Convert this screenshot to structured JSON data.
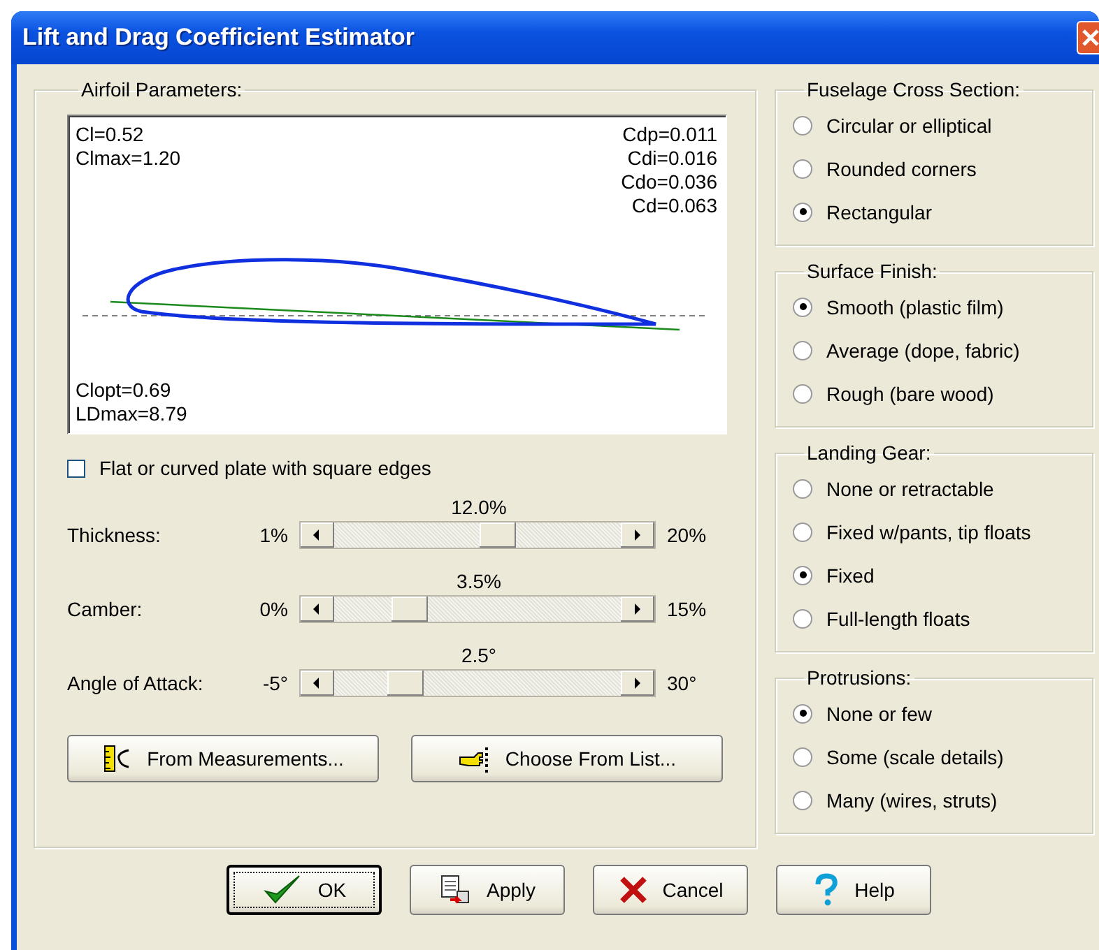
{
  "window": {
    "title": "Lift and Drag Coefficient Estimator"
  },
  "airfoil": {
    "legend": "Airfoil Parameters:",
    "readouts_top_left": [
      "Cl=0.52",
      "Clmax=1.20"
    ],
    "readouts_top_right": [
      "Cdp=0.011",
      "Cdi=0.016",
      "Cdo=0.036",
      "Cd=0.063"
    ],
    "readouts_bottom_left": [
      "Clopt=0.69",
      "LDmax=8.79"
    ],
    "flat_plate": {
      "label": "Flat or curved plate with square edges",
      "checked": false
    },
    "sliders": [
      {
        "label": "Thickness:",
        "min_label": "1%",
        "max_label": "20%",
        "reading": "12.0%",
        "level": 0.58
      },
      {
        "label": "Camber:",
        "min_label": "0%",
        "max_label": "15%",
        "reading": "3.5%",
        "level": 0.23
      },
      {
        "label": "Angle of Attack:",
        "min_label": "-5°",
        "max_label": "30°",
        "reading": "2.5°",
        "level": 0.21
      }
    ],
    "buttons": [
      {
        "label": "From Measurements...",
        "kind": "measure"
      },
      {
        "label": "Choose From List...",
        "kind": "list"
      }
    ]
  },
  "groups": [
    {
      "title": "Fuselage Cross Section:",
      "options": [
        {
          "label": "Circular or elliptical",
          "selected": false
        },
        {
          "label": "Rounded corners",
          "selected": false
        },
        {
          "label": "Rectangular",
          "selected": true
        }
      ]
    },
    {
      "title": "Surface Finish:",
      "options": [
        {
          "label": "Smooth (plastic film)",
          "selected": true
        },
        {
          "label": "Average (dope, fabric)",
          "selected": false
        },
        {
          "label": "Rough (bare wood)",
          "selected": false
        }
      ]
    },
    {
      "title": "Landing Gear:",
      "options": [
        {
          "label": "None or retractable",
          "selected": false
        },
        {
          "label": "Fixed w/pants, tip floats",
          "selected": false
        },
        {
          "label": "Fixed",
          "selected": true
        },
        {
          "label": "Full-length floats",
          "selected": false
        }
      ]
    },
    {
      "title": "Protrusions:",
      "options": [
        {
          "label": "None or few",
          "selected": true
        },
        {
          "label": "Some (scale details)",
          "selected": false
        },
        {
          "label": "Many (wires, struts)",
          "selected": false
        }
      ]
    }
  ],
  "dialog_buttons": [
    {
      "label": "OK",
      "kind": "ok",
      "default": true
    },
    {
      "label": "Apply",
      "kind": "apply",
      "default": false
    },
    {
      "label": "Cancel",
      "kind": "cancel",
      "default": false
    },
    {
      "label": "Help",
      "kind": "help",
      "default": false
    }
  ]
}
